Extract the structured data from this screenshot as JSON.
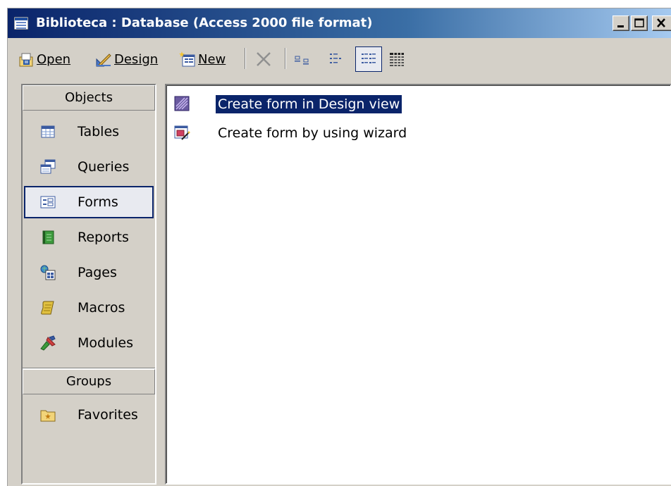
{
  "window": {
    "title": "Biblioteca : Database (Access 2000 file format)",
    "min_label": "_",
    "max_label": "□",
    "close_label": "×"
  },
  "toolbar": {
    "open_label": "Open",
    "design_label": "Design",
    "new_label": "New"
  },
  "sidebar": {
    "objects_header": "Objects",
    "groups_header": "Groups",
    "items": [
      {
        "label": "Tables",
        "icon": "table-icon"
      },
      {
        "label": "Queries",
        "icon": "query-icon"
      },
      {
        "label": "Forms",
        "icon": "form-icon",
        "selected": true
      },
      {
        "label": "Reports",
        "icon": "report-icon"
      },
      {
        "label": "Pages",
        "icon": "page-icon"
      },
      {
        "label": "Macros",
        "icon": "macro-icon"
      },
      {
        "label": "Modules",
        "icon": "module-icon"
      }
    ],
    "groups": [
      {
        "label": "Favorites",
        "icon": "favorites-folder-icon"
      }
    ]
  },
  "main": {
    "items": [
      {
        "label": "Create form in Design view",
        "icon": "design-view-icon",
        "selected": true
      },
      {
        "label": "Create form by using wizard",
        "icon": "wizard-icon"
      }
    ]
  },
  "colors": {
    "title_gradient_start": "#0a246a",
    "title_gradient_end": "#a6caf0",
    "face": "#d4d0c8",
    "selection": "#0a246a"
  }
}
